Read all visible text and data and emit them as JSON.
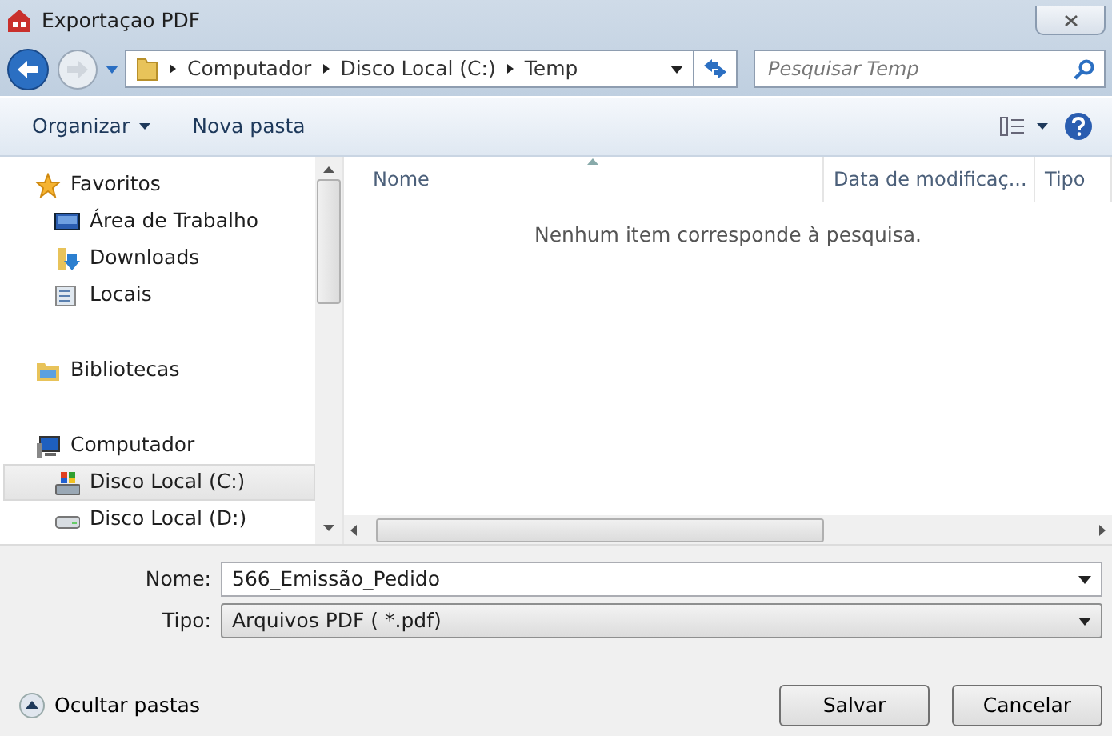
{
  "window": {
    "title": "Exportaçao PDF"
  },
  "address": {
    "crumbs": [
      "Computador",
      "Disco Local (C:)",
      "Temp"
    ]
  },
  "search": {
    "placeholder": "Pesquisar Temp"
  },
  "toolbar": {
    "buttons": [
      {
        "label": "Organizar",
        "dropdown": true
      },
      {
        "label": "Nova pasta",
        "dropdown": false
      }
    ]
  },
  "sidebar": {
    "items": [
      {
        "label": "Favoritos",
        "kind": "group",
        "selected": false
      },
      {
        "label": "Área de Trabalho",
        "kind": "item",
        "selected": false
      },
      {
        "label": "Downloads",
        "kind": "item",
        "selected": false
      },
      {
        "label": "Locais",
        "kind": "item",
        "selected": false
      },
      {
        "label": "Bibliotecas",
        "kind": "group",
        "selected": false
      },
      {
        "label": "Computador",
        "kind": "group",
        "selected": false
      },
      {
        "label": "Disco Local (C:)",
        "kind": "item",
        "selected": true
      },
      {
        "label": "Disco Local (D:)",
        "kind": "item",
        "selected": false
      }
    ]
  },
  "file_list": {
    "columns": [
      "Nome",
      "Data de modificaç...",
      "Tipo"
    ],
    "empty_message": "Nenhum item corresponde à pesquisa."
  },
  "form": {
    "name_label": "Nome:",
    "name_value": "566_Emissão_Pedido",
    "type_label": "Tipo:",
    "type_value": "Arquivos PDF  ( *.pdf)"
  },
  "footer": {
    "toggle": "Ocultar pastas",
    "buttons": [
      "Salvar",
      "Cancelar"
    ]
  }
}
